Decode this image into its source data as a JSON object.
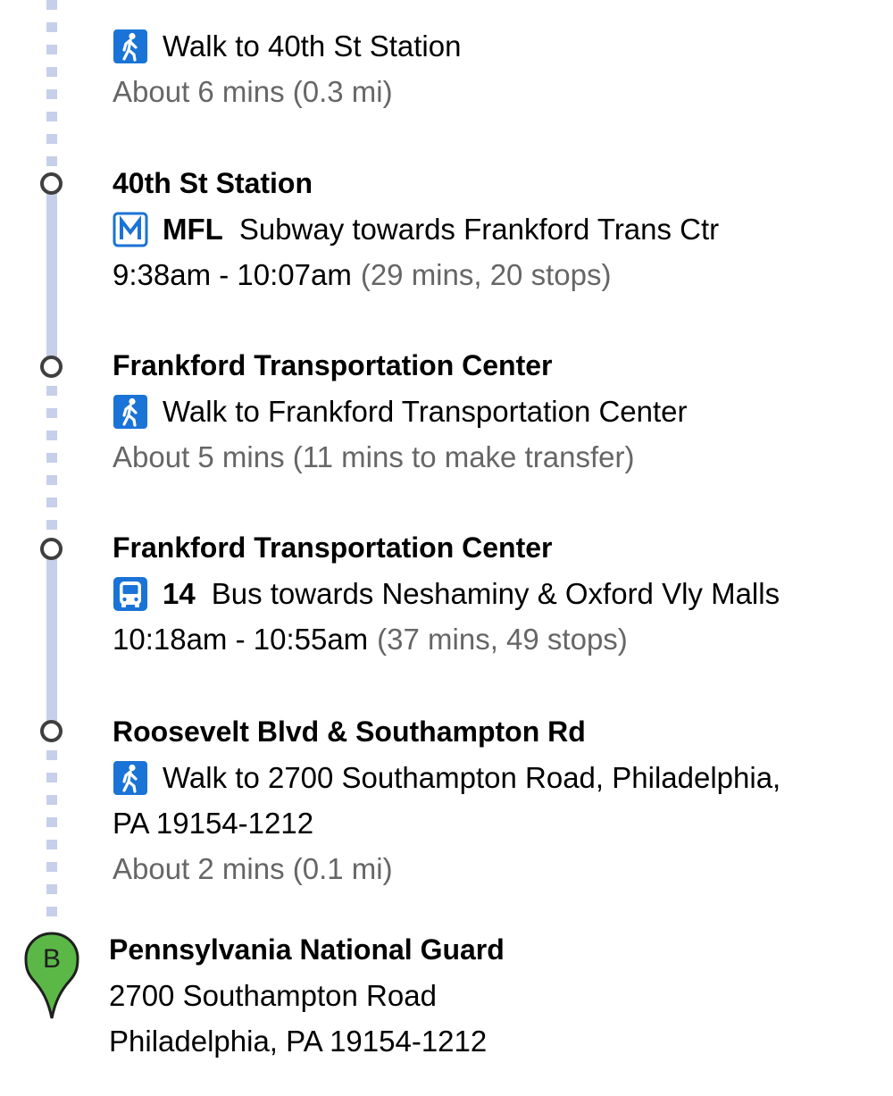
{
  "colors": {
    "route_line": "#c7d0ea",
    "icon_blue": "#1a73d6",
    "muted_text": "#666666",
    "marker_green": "#5bb846",
    "stop_circle": "#3f3f3f"
  },
  "steps": [
    {
      "type": "walk",
      "icon": "walk-icon",
      "instruction": "Walk to 40th St Station",
      "duration": "About 6 mins (0.3 mi)"
    },
    {
      "type": "transit",
      "stop_name": "40th St Station",
      "icon": "subway-icon",
      "route": "MFL",
      "instruction": "Subway towards Frankford Trans Ctr",
      "time_range": "9:38am - 10:07am",
      "details": "(29 mins, 20 stops)"
    },
    {
      "type": "walk",
      "stop_name": "Frankford Transportation Center",
      "icon": "walk-icon",
      "instruction": "Walk to Frankford Transportation Center",
      "duration": "About 5 mins (11 mins to make transfer)"
    },
    {
      "type": "transit",
      "stop_name": "Frankford Transportation Center",
      "icon": "bus-icon",
      "route": "14",
      "instruction": "Bus towards Neshaminy & Oxford Vly Malls",
      "time_range": "10:18am - 10:55am",
      "details": "(37 mins, 49 stops)"
    },
    {
      "type": "walk",
      "stop_name": "Roosevelt Blvd & Southampton Rd",
      "icon": "walk-icon",
      "instruction": "Walk to 2700 Southampton Road, Philadelphia,",
      "instruction_cont": "PA 19154-1212",
      "duration": "About 2 mins (0.1 mi)"
    }
  ],
  "destination": {
    "marker_label": "B",
    "name": "Pennsylvania National Guard",
    "address_line1": "2700 Southampton Road",
    "address_line2": "Philadelphia, PA 19154-1212"
  }
}
